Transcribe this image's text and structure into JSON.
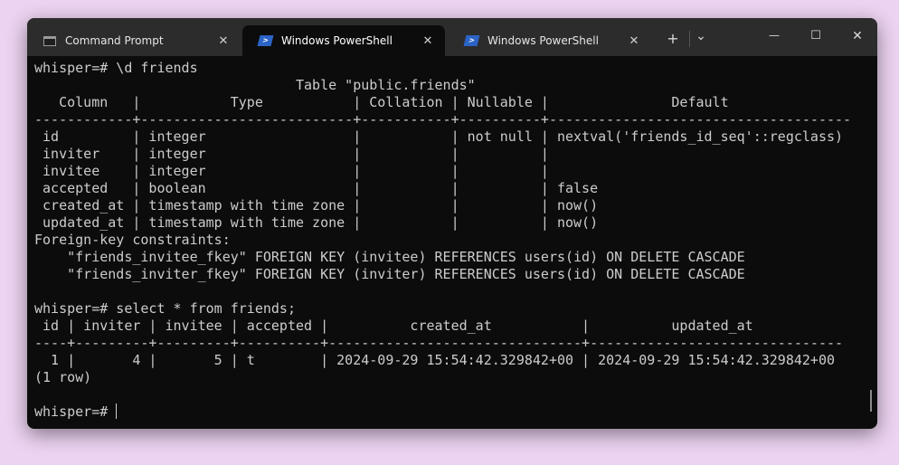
{
  "tabs": [
    {
      "label": "Command Prompt",
      "icon": "cmd-icon"
    },
    {
      "label": "Windows PowerShell",
      "icon": "powershell-icon"
    },
    {
      "label": "Windows PowerShell",
      "icon": "powershell-icon"
    }
  ],
  "tab_close_glyph": "✕",
  "controls": {
    "new_tab": "+",
    "dropdown": "⌄",
    "minimize": "—",
    "maximize": "☐",
    "close": "✕"
  },
  "terminal": {
    "lines": [
      "whisper=# \\d friends",
      "                                Table \"public.friends\"",
      "   Column   |           Type           | Collation | Nullable |               Default",
      "------------+--------------------------+-----------+----------+-------------------------------------",
      " id         | integer                  |           | not null | nextval('friends_id_seq'::regclass)",
      " inviter    | integer                  |           |          |",
      " invitee    | integer                  |           |          |",
      " accepted   | boolean                  |           |          | false",
      " created_at | timestamp with time zone |           |          | now()",
      " updated_at | timestamp with time zone |           |          | now()",
      "Foreign-key constraints:",
      "    \"friends_invitee_fkey\" FOREIGN KEY (invitee) REFERENCES users(id) ON DELETE CASCADE",
      "    \"friends_inviter_fkey\" FOREIGN KEY (inviter) REFERENCES users(id) ON DELETE CASCADE",
      "",
      "whisper=# select * from friends;",
      " id | inviter | invitee | accepted |          created_at           |          updated_at",
      "----+---------+---------+----------+-------------------------------+-------------------------------",
      "  1 |       4 |       5 | t        | 2024-09-29 15:54:42.329842+00 | 2024-09-29 15:54:42.329842+00",
      "(1 row)",
      ""
    ],
    "prompt": "whisper=# "
  }
}
